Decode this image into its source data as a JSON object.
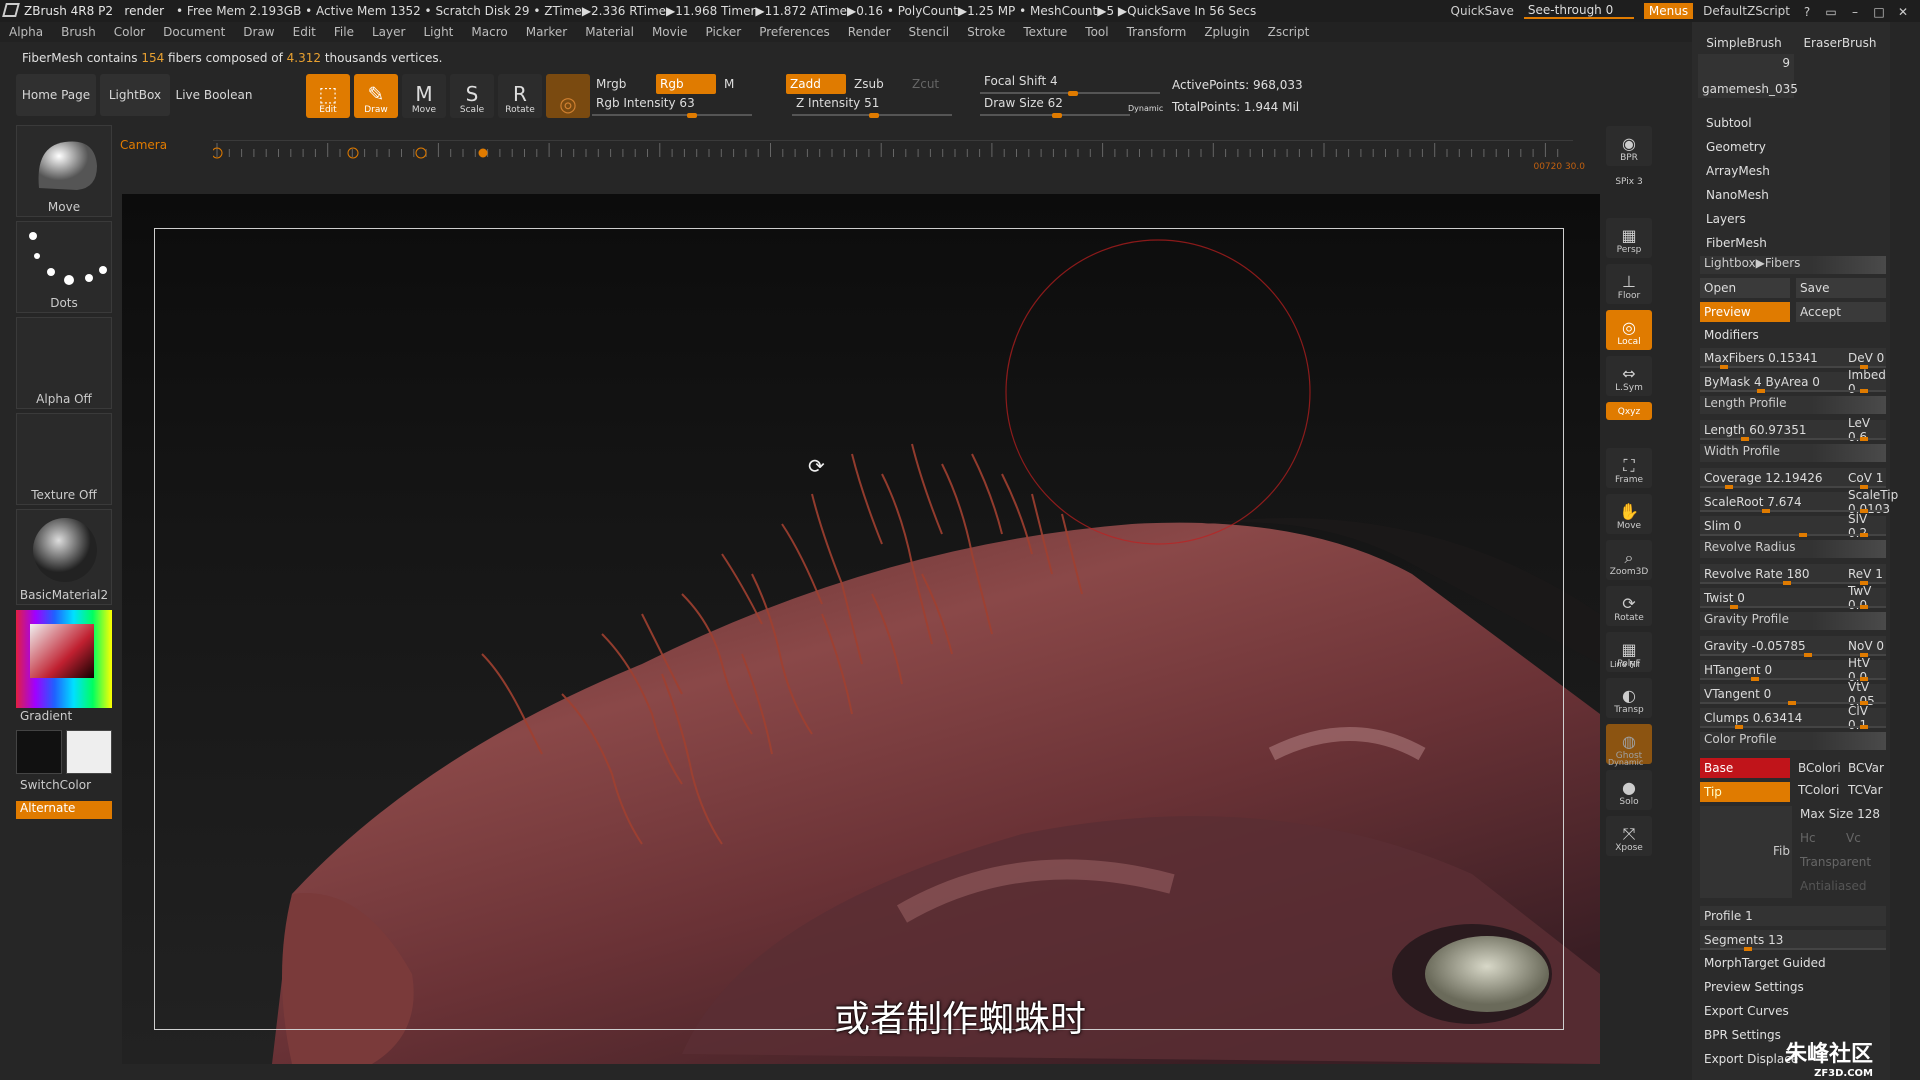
{
  "titlebar": {
    "app": "ZBrush 4R8 P2",
    "doc": "render",
    "stats": "• Free Mem 2.193GB • Active Mem 1352 • Scratch Disk 29 •  ZTime▶2.336 RTime▶11.968 Timer▶11.872 ATime▶0.16 • PolyCount▶1.25 MP  • MeshCount▶5  ▶QuickSave In 56 Secs",
    "quicksave": "QuickSave",
    "see_through": "See-through  0",
    "menus": "Menus",
    "script": "DefaultZScript"
  },
  "menubar": [
    "Alpha",
    "Brush",
    "Color",
    "Document",
    "Draw",
    "Edit",
    "File",
    "Layer",
    "Light",
    "Macro",
    "Marker",
    "Material",
    "Movie",
    "Picker",
    "Preferences",
    "Render",
    "Stencil",
    "Stroke",
    "Texture",
    "Tool",
    "Transform",
    "Zplugin",
    "Zscript"
  ],
  "notice": {
    "prefix": "FiberMesh contains ",
    "fibers": "154",
    "middle": " fibers composed of ",
    "verts": "4.312",
    "suffix": " thousands vertices."
  },
  "toolbar": {
    "home_page": "Home Page",
    "lightbox": "LightBox",
    "live_boolean": "Live Boolean",
    "tools": [
      {
        "name": "edit",
        "label": "Edit",
        "glyph": "⬚",
        "active": true
      },
      {
        "name": "draw",
        "label": "Draw",
        "glyph": "✎",
        "active": true
      },
      {
        "name": "move",
        "label": "Move",
        "glyph": "M",
        "active": false
      },
      {
        "name": "scale",
        "label": "Scale",
        "glyph": "S",
        "active": false
      },
      {
        "name": "rotate",
        "label": "Rotate",
        "glyph": "R",
        "active": false
      }
    ],
    "mrgb": "Mrgb",
    "rgb": "Rgb",
    "m": "M",
    "zadd": "Zadd",
    "zsub": "Zsub",
    "zcut": "Zcut",
    "rgb_intensity": "Rgb Intensity 63",
    "rgb_intensity_value": 63,
    "z_intensity": "Z Intensity 51",
    "z_intensity_value": 51,
    "focal_shift": "Focal Shift 4",
    "focal_shift_value": 4,
    "draw_size": "Draw Size 62",
    "draw_size_value": 62,
    "dynamic": "Dynamic",
    "active_points": "ActivePoints: 968,033",
    "total_points": "TotalPoints: 1.944 Mil"
  },
  "timeline": {
    "camera": "Camera",
    "readout": "00720  30.0"
  },
  "leftshelf": {
    "move": "Move",
    "dots": "Dots",
    "alpha": "Alpha Off",
    "texture": "Texture Off",
    "material": "BasicMaterial2",
    "gradient": "Gradient",
    "switchcolor": "SwitchColor",
    "alternate": "Alternate"
  },
  "righticons": [
    {
      "name": "bpr",
      "label": "BPR",
      "glyph": "◉"
    },
    {
      "name": "spix",
      "label": "SPix 3",
      "glyph": ""
    },
    {
      "name": "persp",
      "label": "Persp",
      "glyph": "▦"
    },
    {
      "name": "floor",
      "label": "Floor",
      "glyph": "⊥"
    },
    {
      "name": "local",
      "label": "Local",
      "glyph": "◎"
    },
    {
      "name": "lsym",
      "label": "L.Sym",
      "glyph": "⇔"
    },
    {
      "name": "xyz",
      "label": "Qxyz",
      "glyph": ""
    },
    {
      "name": "frame",
      "label": "Frame",
      "glyph": "⛶"
    },
    {
      "name": "move",
      "label": "Move",
      "glyph": "✋"
    },
    {
      "name": "zoom3d",
      "label": "Zoom3D",
      "glyph": "⌕"
    },
    {
      "name": "rotate",
      "label": "Rotate",
      "glyph": "⟳"
    },
    {
      "name": "polyf",
      "label": "PolyF",
      "glyph": "▦"
    },
    {
      "name": "transp",
      "label": "Transp",
      "glyph": "◐"
    },
    {
      "name": "ghost",
      "label": "Ghost",
      "glyph": "◍"
    },
    {
      "name": "solo",
      "label": "Solo",
      "glyph": "●"
    },
    {
      "name": "xpose",
      "label": "Xpose",
      "glyph": "⤧"
    }
  ],
  "linefill": "Line Fill",
  "dynamic_label": "Dynamic",
  "rightpanel": {
    "simplebrush": "SimpleBrush",
    "eraserbrush": "EraserBrush",
    "gamemesh": "gamemesh_035",
    "gamemesh_count": "9",
    "menu": [
      "Subtool",
      "Geometry",
      "ArrayMesh",
      "NanoMesh",
      "Layers",
      "FiberMesh"
    ],
    "lightbox_fibers": "Lightbox▶Fibers",
    "open": "Open",
    "save": "Save",
    "preview": "Preview",
    "accept": "Accept",
    "modifiers": "Modifiers",
    "rows": [
      {
        "l": "MaxFibers 0.15341",
        "r": "DeV 0"
      },
      {
        "l": "ByMask 4   ByArea 0",
        "r": "Imbed 0"
      },
      {
        "l": "Length Profile",
        "r": "",
        "hdr": true
      },
      {
        "l": "Length 60.97351",
        "r": "LeV 0.6"
      },
      {
        "l": "Width Profile",
        "r": "",
        "hdr": true
      },
      {
        "l": "Coverage 12.19426",
        "r": "CoV 1"
      },
      {
        "l": "ScaleRoot 7.674",
        "r": "ScaleTip 0.0103"
      },
      {
        "l": "Slim 0",
        "r": "SlV 0.2"
      },
      {
        "l": "Revolve Radius",
        "r": "",
        "hdr": true
      },
      {
        "l": "Revolve Rate 180",
        "r": "ReV 1"
      },
      {
        "l": "Twist 0",
        "r": "TwV 0.0"
      },
      {
        "l": "Gravity Profile",
        "r": "",
        "hdr": true
      },
      {
        "l": "Gravity -0.05785",
        "r": "NoV 0"
      },
      {
        "l": "HTangent 0",
        "r": "HtV 0.0"
      },
      {
        "l": "VTangent 0",
        "r": "VtV 0.05"
      },
      {
        "l": "Clumps 0.63414",
        "r": "ClV 0.1"
      },
      {
        "l": "Color Profile",
        "r": "",
        "hdr": true
      }
    ],
    "base": "Base",
    "tip": "Tip",
    "bcolor": "BColori",
    "bcvar": "BCVar",
    "tcolor": "TColori",
    "tcvar": "TCVar",
    "maxsize": "Max Size 128",
    "hc": "Hc",
    "vc": "Vc",
    "fib": "Fib",
    "transparent": "Transparent",
    "antialiased": "Antialiased",
    "profile": "Profile 1",
    "segments": "Segments 13",
    "bottom_items": [
      "MorphTarget Guided",
      "Preview Settings",
      "Export Curves",
      "BPR Settings",
      "Export Displace"
    ]
  },
  "subtitle": "或者制作蜘蛛时",
  "watermark": {
    "main": "朱峰社区",
    "url": "ZF3D.COM"
  }
}
